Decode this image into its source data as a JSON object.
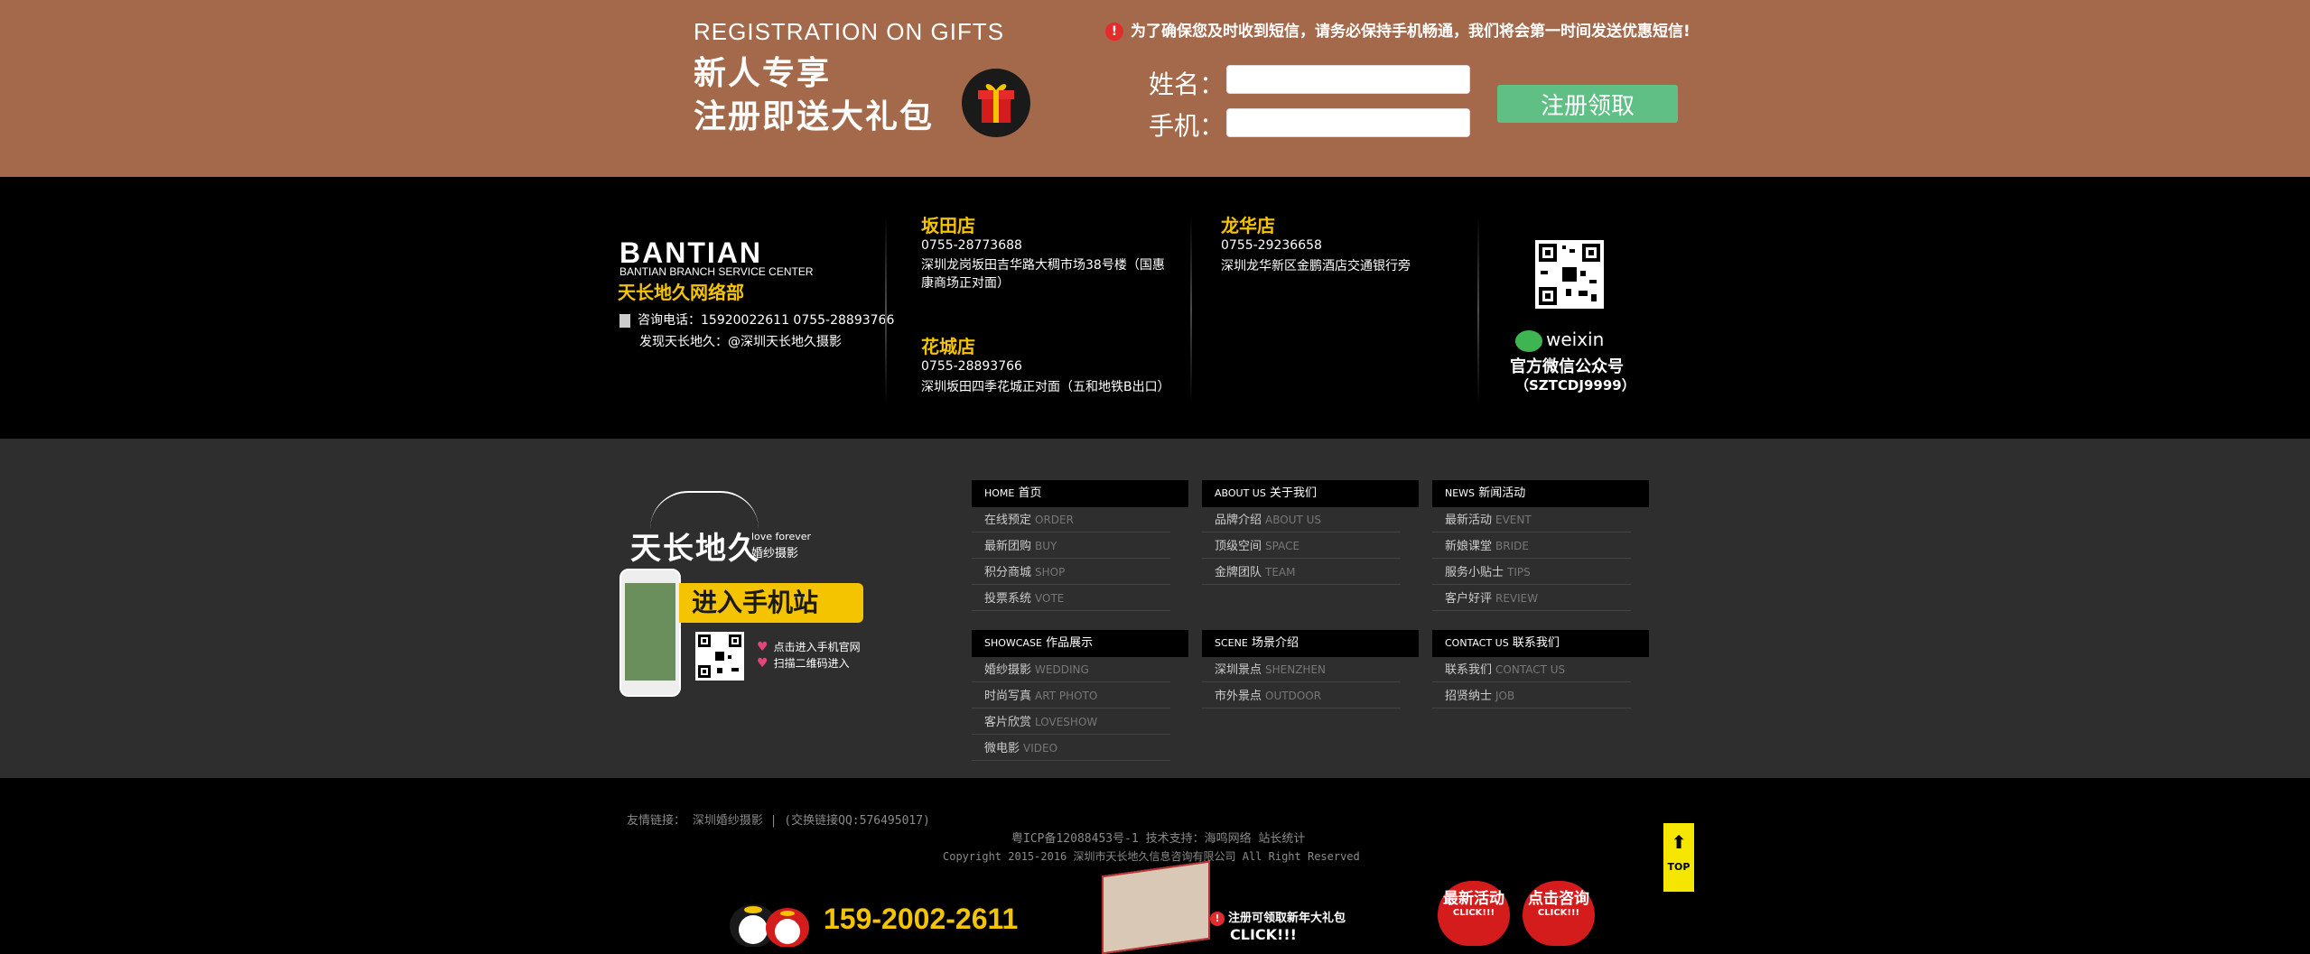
{
  "registration": {
    "title_en": "REGISTRATION ON GIFTS",
    "title_cn_1": "新人专享",
    "title_cn_2": "注册即送大礼包",
    "notice": "为了确保您及时收到短信，请务必保持手机畅通，我们将会第一时间发送优惠短信!",
    "notice_icon": "!",
    "name_label": "姓名：",
    "phone_label": "手机：",
    "name_value": "",
    "phone_value": "",
    "submit_label": "注册领取",
    "accent": "#5fbf85",
    "background": "#a4694a"
  },
  "branch": {
    "name_en": "BANTIAN",
    "subtitle_en": "BANTIAN BRANCH SERVICE CENTER",
    "name_cn": "天长地久网络部",
    "phone": "咨询电话：15920022611 0755-28893766",
    "discover": "发现天长地久：@深圳天长地久摄影"
  },
  "stores": [
    {
      "name": "坂田店",
      "tel": "0755-28773688",
      "address": "深圳龙岗坂田吉华路大稠市场38号楼（国惠康商场正对面）"
    },
    {
      "name": "龙华店",
      "tel": "0755-29236658",
      "address": "深圳龙华新区金鹏酒店交通银行旁"
    },
    {
      "name": "花城店",
      "tel": "0755-28893766",
      "address": "深圳坂田四季花城正对面（五和地铁B出口）"
    }
  ],
  "wechat": {
    "brand": "weixin",
    "title": "官方微信公众号",
    "account": "（SZTCDJ9999）"
  },
  "footer_brand": {
    "logo_cn": "天长地久",
    "logo_en": "love forever",
    "logo_cn_sub": "婚纱摄影",
    "mobile_site": "进入手机站",
    "note_1": "点击进入手机官网",
    "note_2": "扫描二维码进入",
    "heart_icon": "♥"
  },
  "menus": [
    {
      "head_en": "HOME",
      "head_cn": "首页",
      "items": [
        {
          "cn": "在线预定",
          "en": "ORDER"
        },
        {
          "cn": "最新团购",
          "en": "BUY"
        },
        {
          "cn": "积分商城",
          "en": "SHOP"
        },
        {
          "cn": "投票系统",
          "en": "VOTE"
        }
      ]
    },
    {
      "head_en": "ABOUT US",
      "head_cn": "关于我们",
      "items": [
        {
          "cn": "品牌介绍",
          "en": "ABOUT US"
        },
        {
          "cn": "顶级空间",
          "en": "SPACE"
        },
        {
          "cn": "金牌团队",
          "en": "TEAM"
        }
      ]
    },
    {
      "head_en": "NEWS",
      "head_cn": "新闻活动",
      "items": [
        {
          "cn": "最新活动",
          "en": "EVENT"
        },
        {
          "cn": "新娘课堂",
          "en": "BRIDE"
        },
        {
          "cn": "服务小贴士",
          "en": "TIPS"
        },
        {
          "cn": "客户好评",
          "en": "REVIEW"
        }
      ]
    },
    {
      "head_en": "SHOWCASE",
      "head_cn": "作品展示",
      "items": [
        {
          "cn": "婚纱摄影",
          "en": "WEDDING"
        },
        {
          "cn": "时尚写真",
          "en": "ART PHOTO"
        },
        {
          "cn": "客片欣赏",
          "en": "LOVESHOW"
        },
        {
          "cn": "微电影",
          "en": "VIDEO"
        }
      ]
    },
    {
      "head_en": "SCENE",
      "head_cn": "场景介绍",
      "items": [
        {
          "cn": "深圳景点",
          "en": "SHENZHEN"
        },
        {
          "cn": "市外景点",
          "en": "OUTDOOR"
        }
      ]
    },
    {
      "head_en": "CONTACT US",
      "head_cn": "联系我们",
      "items": [
        {
          "cn": "联系我们",
          "en": "CONTACT US"
        },
        {
          "cn": "招贤纳士",
          "en": "JOB"
        }
      ]
    }
  ],
  "bottom": {
    "links": "友情链接：  深圳婚纱摄影 | (交换链接QQ:576495017)",
    "icp": "粤ICP备12088453号-1 技术支持：海鸣网络 站长统计",
    "copyright": "Copyright 2015-2016 深圳市天长地久信息咨询有限公司 All Right Reserved",
    "top_label": "TOP",
    "top_arrow": "⬆",
    "hotline": "159-2002-2611",
    "promo": "注册可领取新年大礼包",
    "promo_icon": "!",
    "click": "CLICK!!!",
    "badge_1": "最新活动",
    "badge_1_sub": "CLICK!!!",
    "badge_2": "点击咨询",
    "badge_2_sub": "CLICK!!!"
  }
}
